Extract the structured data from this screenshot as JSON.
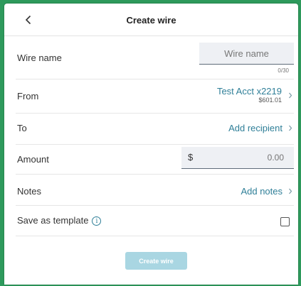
{
  "header": {
    "back_icon": "chevron-left-icon",
    "title": "Create wire"
  },
  "wire_name": {
    "label": "Wire name",
    "placeholder": "Wire name",
    "value": "",
    "counter": "0/30"
  },
  "from": {
    "label": "From",
    "account": "Test Acct x2219",
    "balance": "$601.01"
  },
  "to": {
    "label": "To",
    "action": "Add recipient"
  },
  "amount": {
    "label": "Amount",
    "currency": "$",
    "value": "0.00"
  },
  "notes": {
    "label": "Notes",
    "action": "Add notes"
  },
  "template": {
    "label": "Save as template",
    "info_icon": "info-icon",
    "checked": false
  },
  "footer": {
    "create_label": "Create wire"
  },
  "colors": {
    "accent": "#2f7f98",
    "button_disabled": "#a9d6e2",
    "background": "#2e9a5c"
  }
}
